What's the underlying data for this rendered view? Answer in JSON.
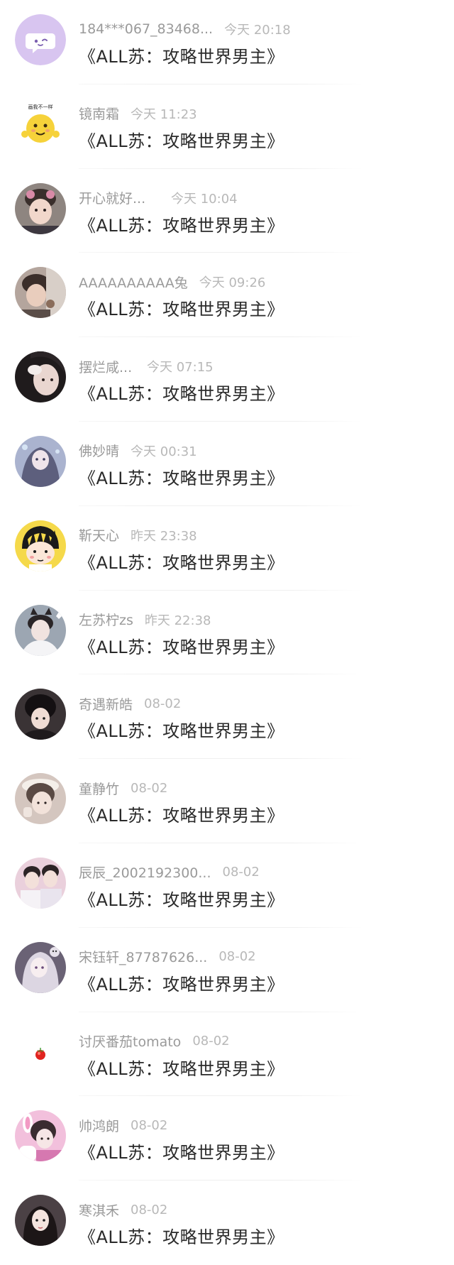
{
  "comments": [
    {
      "username": "184***067_83468...",
      "time": "今天 20:18",
      "title": "《ALL苏：攻略世界男主》",
      "avatar_icon": "chat-bubble-emoji-icon",
      "avatar_color": "#d7c3f0"
    },
    {
      "username": "镜南霜",
      "time": "今天 11:23",
      "title": "《ALL苏：攻略世界男主》",
      "avatar_icon": "yellow-face-emoji-icon",
      "avatar_text": "画我不一样",
      "avatar_color": "#f6d23a"
    },
    {
      "username": "开心就好...",
      "time": "今天 10:04",
      "title": "《ALL苏：攻略世界男主》",
      "avatar_icon": "child-photo-icon",
      "avatar_color": "#8a7f7a"
    },
    {
      "username": "AAAAAAAAAA兔",
      "time": "今天 09:26",
      "title": "《ALL苏：攻略世界男主》",
      "avatar_icon": "boy-photo-icon",
      "avatar_color": "#a38f86"
    },
    {
      "username": "摆烂咸...",
      "time": "今天 07:15",
      "title": "《ALL苏：攻略世界男主》",
      "avatar_icon": "girl-photo-icon",
      "avatar_color": "#2e2a2b"
    },
    {
      "username": "佛妙晴",
      "time": "今天 00:31",
      "title": "《ALL苏：攻略世界男主》",
      "avatar_icon": "anime-girl-icon",
      "avatar_color": "#8e94b8"
    },
    {
      "username": "靳天心",
      "time": "昨天 23:38",
      "title": "《ALL苏：攻略世界男主》",
      "avatar_icon": "cartoon-girl-icon",
      "avatar_color": "#f5d94a"
    },
    {
      "username": "左苏柠zs",
      "time": "昨天 22:38",
      "title": "《ALL苏：攻略世界男主》",
      "avatar_icon": "cat-ear-boy-icon",
      "avatar_color": "#6d7580"
    },
    {
      "username": "奇遇新皓",
      "time": "08-02",
      "title": "《ALL苏：攻略世界男主》",
      "avatar_icon": "dark-hair-boy-icon",
      "avatar_color": "#2a2426"
    },
    {
      "username": "童静竹",
      "time": "08-02",
      "title": "《ALL苏：攻略世界男主》",
      "avatar_icon": "girl-hat-photo-icon",
      "avatar_color": "#c9b7ae"
    },
    {
      "username": "辰辰_2002192300...",
      "time": "08-02",
      "title": "《ALL苏：攻略世界男主》",
      "avatar_icon": "couple-photo-icon",
      "avatar_color": "#e0b5c8"
    },
    {
      "username": "宋钰轩_87787626...",
      "time": "08-02",
      "title": "《ALL苏：攻略世界男主》",
      "avatar_icon": "anime-silver-hair-icon",
      "avatar_color": "#5e5868"
    },
    {
      "username": "讨厌番茄tomato",
      "time": "08-02",
      "title": "《ALL苏：攻略世界男主》",
      "avatar_icon": "tomato-icon",
      "avatar_color": "#ffffff"
    },
    {
      "username": "帅鸿朗",
      "time": "08-02",
      "title": "《ALL苏：攻略世界男主》",
      "avatar_icon": "pink-bunny-girl-icon",
      "avatar_color": "#e8a8d0"
    },
    {
      "username": "寒淇禾",
      "time": "08-02",
      "title": "《ALL苏：攻略世界男主》",
      "avatar_icon": "long-hair-girl-icon",
      "avatar_color": "#2c2426"
    }
  ]
}
